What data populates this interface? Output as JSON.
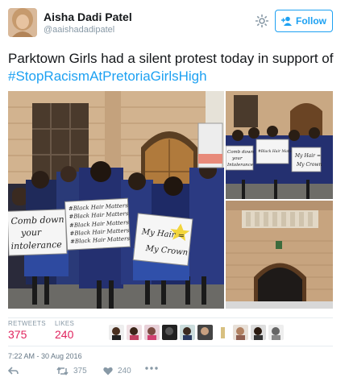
{
  "author": {
    "name": "Aisha Dadi Patel",
    "handle": "@aaishadadipatel"
  },
  "follow_label": "Follow",
  "tweet": {
    "text_before": "Parktown Girls had a silent protest today in support of ",
    "hashtag": "#StopRacismAtPretoriaGirlsHigh"
  },
  "photos": {
    "main_signs": {
      "sign1": [
        "Comb down",
        "your",
        "intolerance"
      ],
      "sign2": [
        "#Black Hair Matters",
        "#Black Hair Matters",
        "#Black Hair Matters",
        "#Black Hair Matters",
        "#Black Hair Matters"
      ],
      "sign3": [
        "My Hair =",
        "My Crown"
      ]
    },
    "top_right_signs": {
      "sign1": [
        "Comb down",
        "your",
        "Intolerance"
      ],
      "sign2": [
        "#Black Hair Matters"
      ],
      "sign3": [
        "My Hair =",
        "My Crown"
      ]
    }
  },
  "stats": {
    "retweets_label": "RETWEETS",
    "retweets": "375",
    "likes_label": "LIKES",
    "likes": "240"
  },
  "timestamp": "7:22 AM - 30 Aug 2016",
  "actions": {
    "retweets": "375",
    "likes": "240"
  },
  "colors": {
    "accent": "#1da1f2",
    "likes": "#e0245e"
  }
}
